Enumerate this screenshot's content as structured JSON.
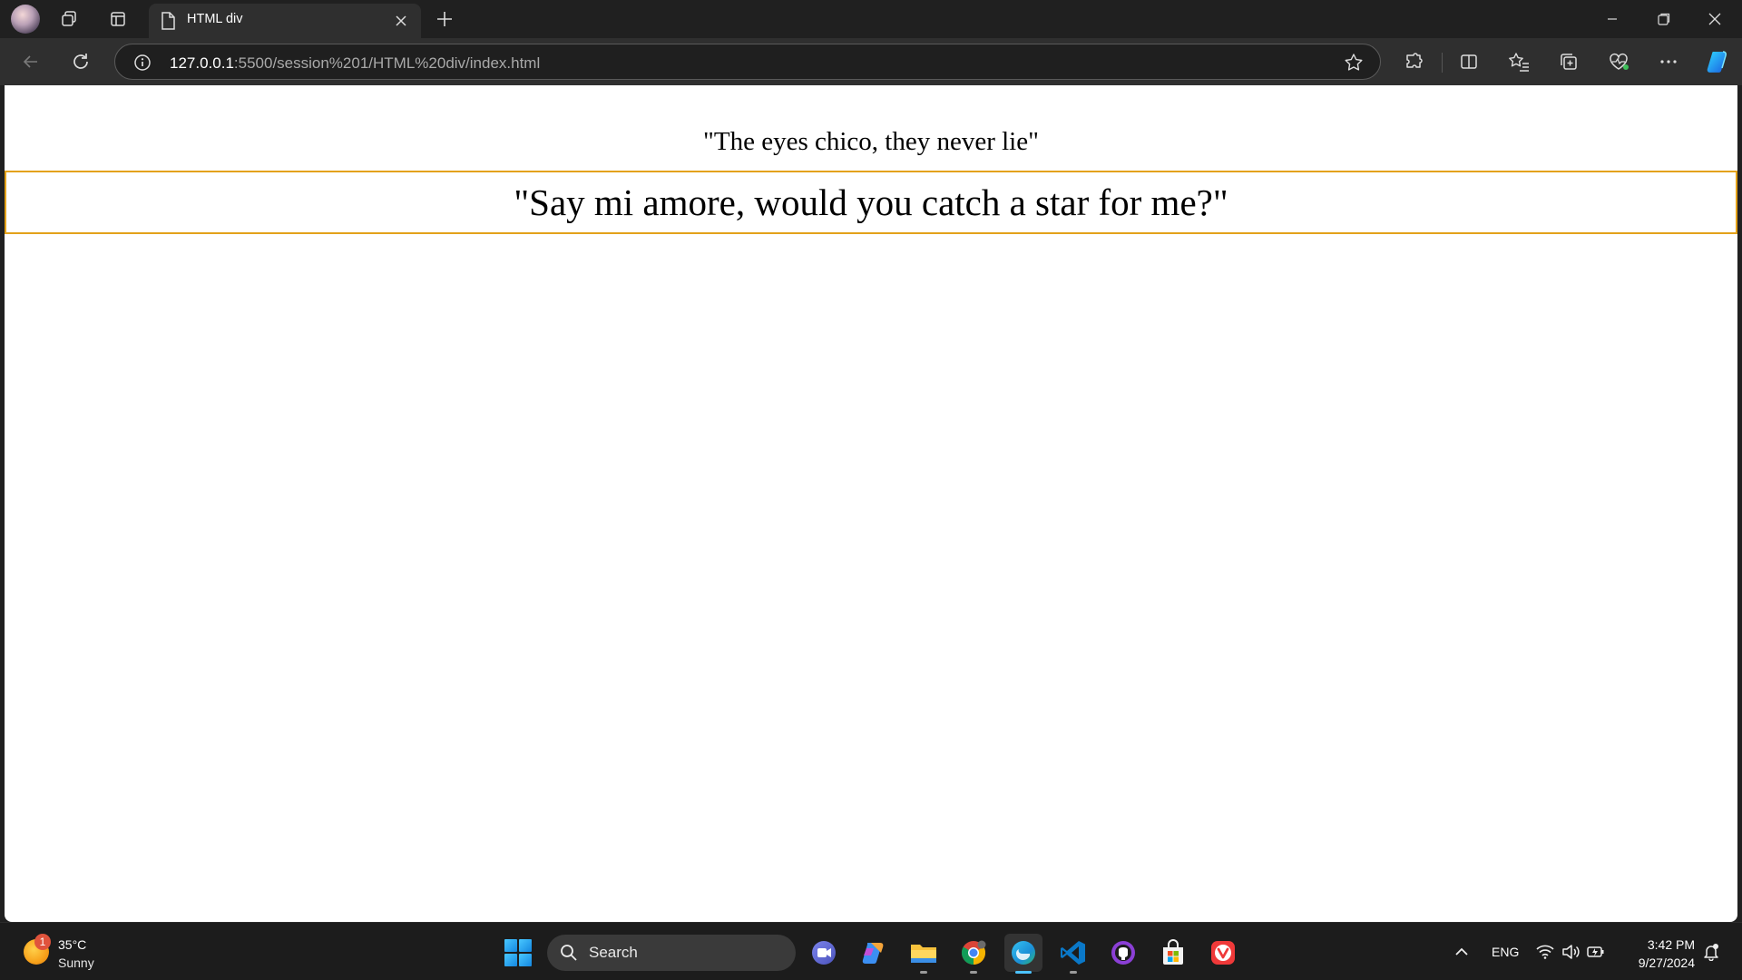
{
  "browser": {
    "tab": {
      "title": "HTML div"
    },
    "address": {
      "host": "127.0.0.1",
      "path": ":5500/session%201/HTML%20div/index.html"
    }
  },
  "page": {
    "paragraph": "\"The eyes chico, they never lie\"",
    "div_quote": "\"Say mi amore, would you catch a star for me?\""
  },
  "taskbar": {
    "weather": {
      "temp": "35°C",
      "condition": "Sunny",
      "badge": "1"
    },
    "search_label": "Search",
    "language": "ENG",
    "time": "3:42 PM",
    "date": "9/27/2024"
  },
  "colors": {
    "div_border": "#e3a21a",
    "chrome_bg": "#202020",
    "toolbar_bg": "#2f2f2f"
  }
}
